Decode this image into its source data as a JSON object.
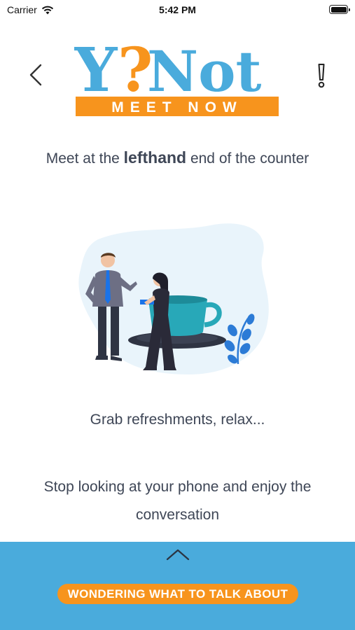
{
  "status": {
    "carrier": "Carrier",
    "time": "5:42 PM",
    "icons": [
      "wifi-icon",
      "battery-icon"
    ]
  },
  "header": {
    "logo_main_y": "Y",
    "logo_main_q": "?",
    "logo_main_not": "Not",
    "logo_sub": "MEET NOW",
    "back_icon": "chevron-left-icon",
    "alert_icon": "exclamation-icon"
  },
  "content": {
    "instruction_pre": "Meet at the ",
    "instruction_strong": "lefthand",
    "instruction_post": " end of the counter",
    "refresh_text": "Grab refreshments, relax...",
    "phone_text": "Stop looking at your phone and enjoy the conversation"
  },
  "bottom": {
    "expand_icon": "chevron-up-icon",
    "talk_button": "WONDERING WHAT TO TALK ABOUT"
  },
  "colors": {
    "brand_blue": "#4aabdc",
    "brand_orange": "#f7941d",
    "text": "#3e4656"
  }
}
